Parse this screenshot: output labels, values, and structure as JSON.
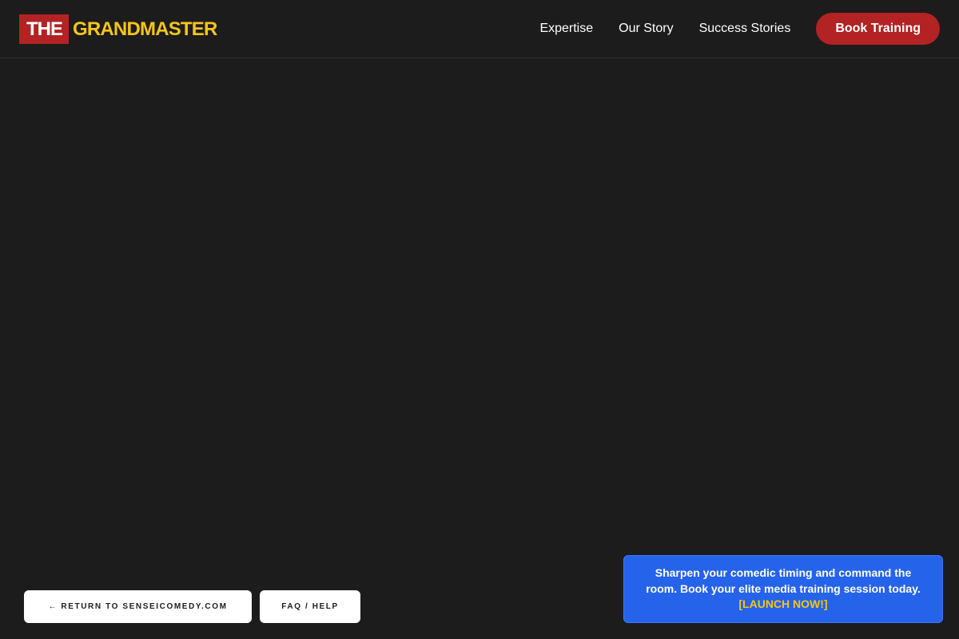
{
  "header": {
    "logo": {
      "prefix": "THE",
      "name": "GRANDMASTER"
    },
    "nav": [
      {
        "label": "Expertise"
      },
      {
        "label": "Our Story"
      },
      {
        "label": "Success Stories"
      }
    ],
    "cta_label": "Book Training"
  },
  "footer_buttons": {
    "return_label": "← RETURN TO SENSEICOMEDY.COM",
    "faq_label": "FAQ / HELP"
  },
  "promo": {
    "text": "Sharpen your comedic timing and command the room. Book your elite media training session today.",
    "cta": "[LAUNCH NOW!]"
  },
  "colors": {
    "background": "#1c1c1c",
    "brand_red": "#b32323",
    "brand_yellow": "#f5c518",
    "promo_blue": "#2563eb"
  }
}
